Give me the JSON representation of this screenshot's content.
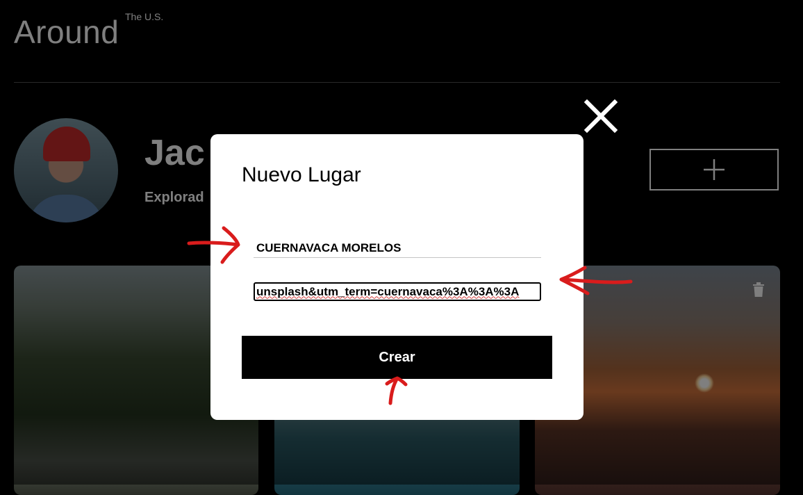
{
  "header": {
    "logo_main": "Around",
    "logo_sub": "The U.S."
  },
  "profile": {
    "name_visible": "Jac",
    "about_visible": "Explorad"
  },
  "modal": {
    "title": "Nuevo Lugar",
    "name_value": "CUERNAVACA MORELOS",
    "url_value": "unsplash&utm_term=cuernavaca%3A%3A%3A",
    "submit_label": "Crear"
  },
  "icons": {
    "close": "close-icon",
    "add": "plus-icon",
    "delete": "trash-icon"
  },
  "colors": {
    "background": "#000000",
    "modal": "#ffffff",
    "annotation": "#d91c1c"
  }
}
